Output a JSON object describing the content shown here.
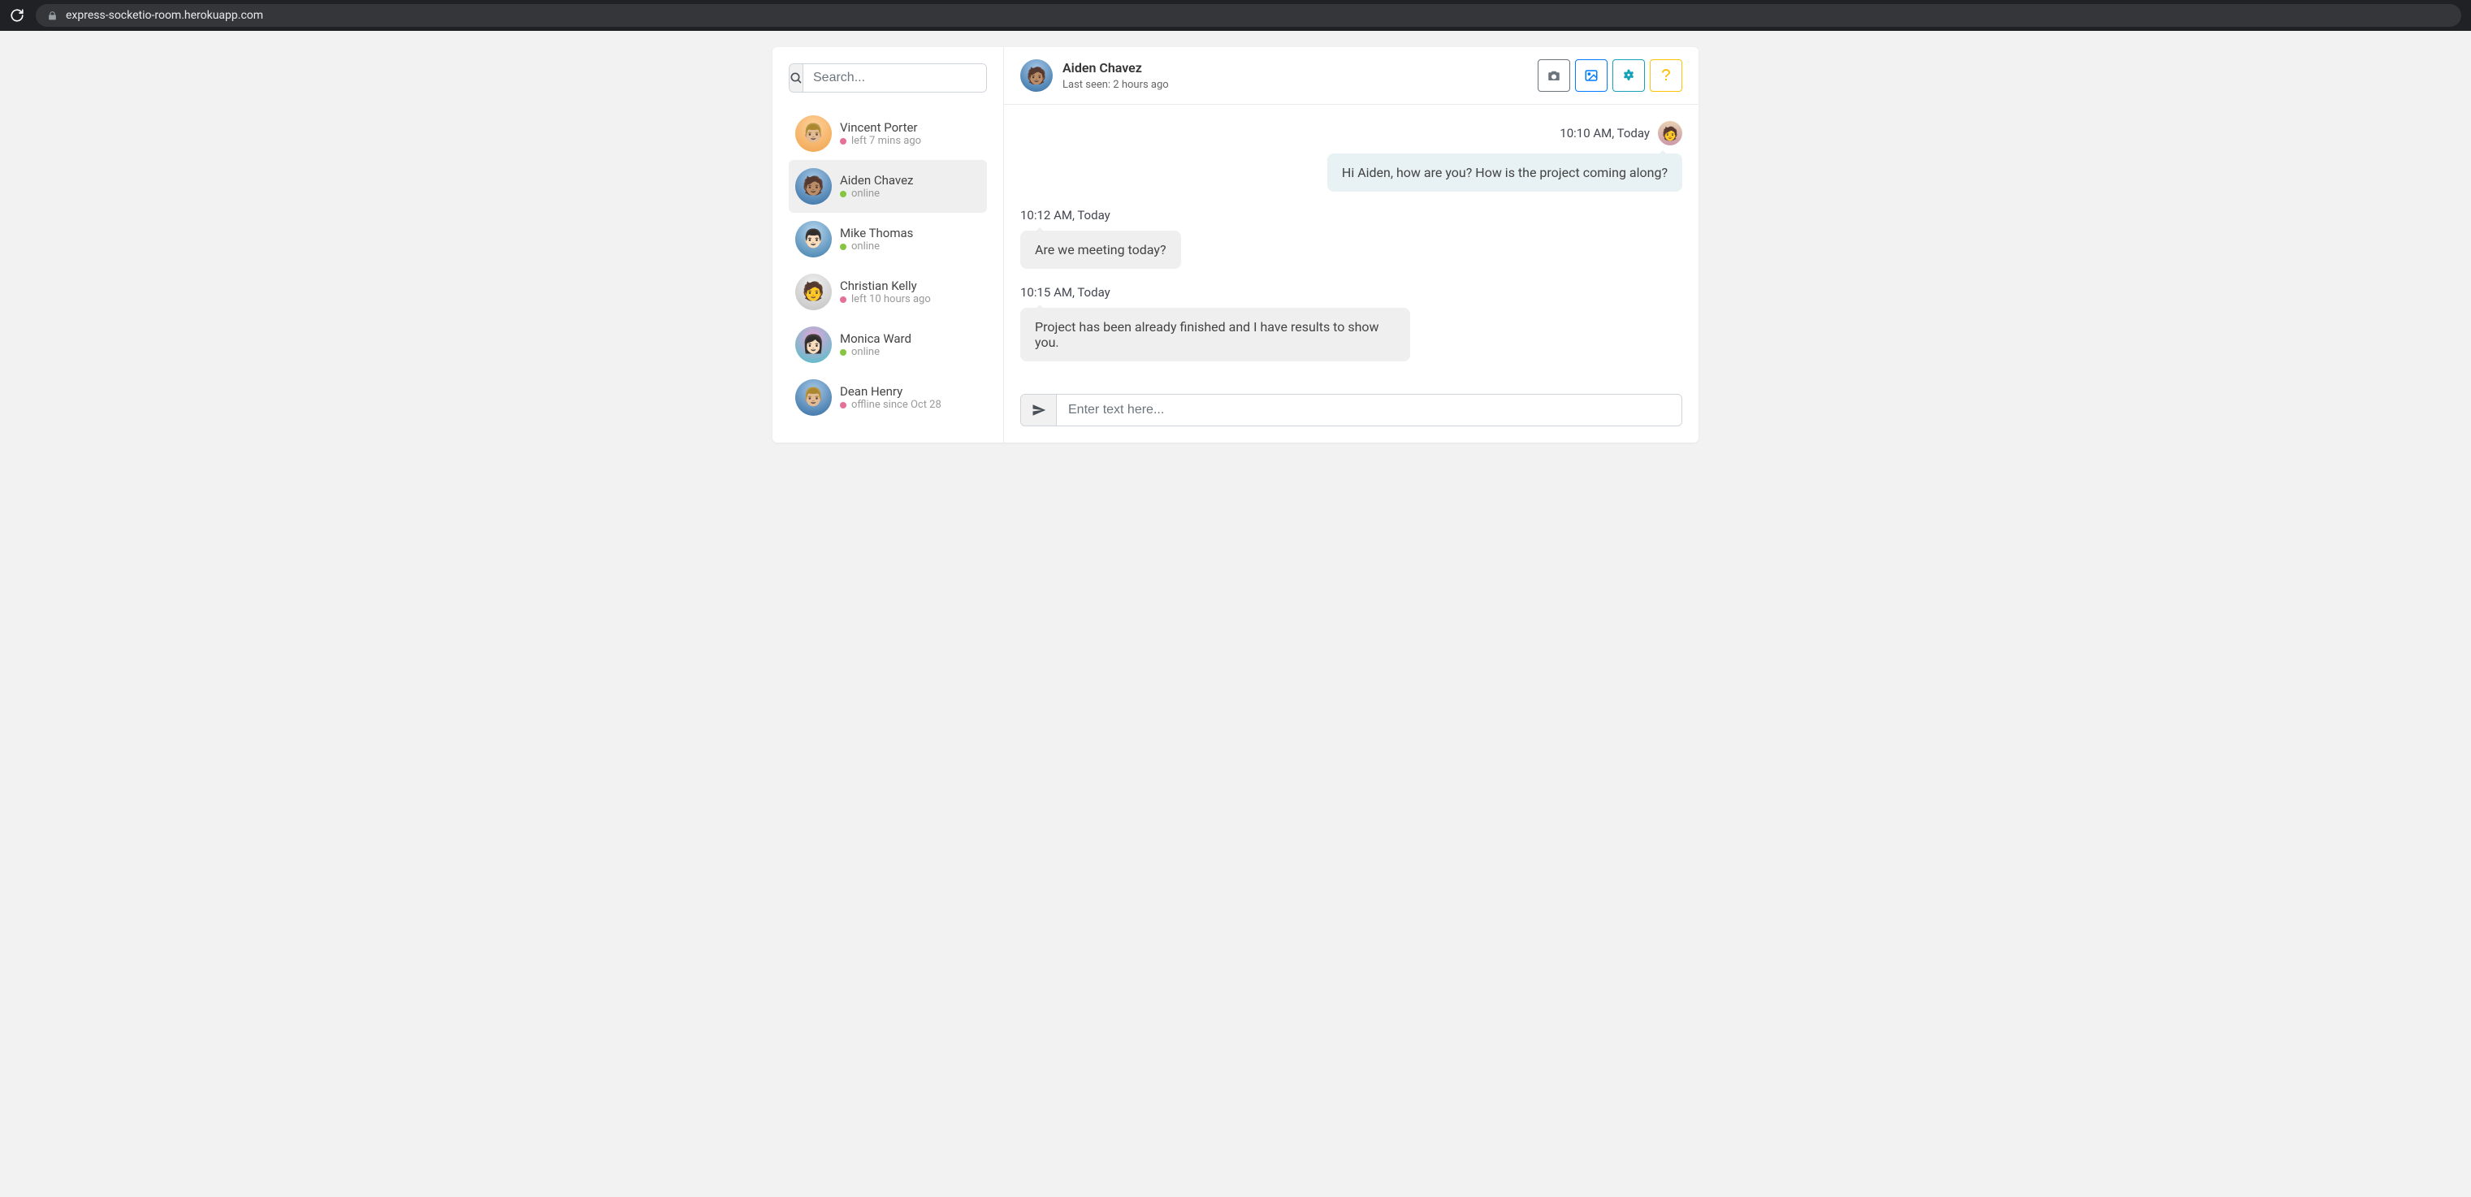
{
  "browser": {
    "url": "express-socketio-room.herokuapp.com"
  },
  "sidebar": {
    "search_placeholder": "Search...",
    "contacts": [
      {
        "name": "Vincent Porter",
        "status_text": "left 7 mins ago",
        "status": "away"
      },
      {
        "name": "Aiden Chavez",
        "status_text": "online",
        "status": "online"
      },
      {
        "name": "Mike Thomas",
        "status_text": "online",
        "status": "online"
      },
      {
        "name": "Christian Kelly",
        "status_text": "left 10 hours ago",
        "status": "away"
      },
      {
        "name": "Monica Ward",
        "status_text": "online",
        "status": "online"
      },
      {
        "name": "Dean Henry",
        "status_text": "offline since Oct 28",
        "status": "offline"
      }
    ]
  },
  "chat": {
    "header": {
      "name": "Aiden Chavez",
      "subtitle": "Last seen: 2 hours ago"
    },
    "messages": [
      {
        "mine": true,
        "time": "10:10 AM, Today",
        "text": "Hi Aiden, how are you? How is the project coming along?"
      },
      {
        "mine": false,
        "time": "10:12 AM, Today",
        "text": "Are we meeting today?"
      },
      {
        "mine": false,
        "time": "10:15 AM, Today",
        "text": "Project has been already finished and I have results to show you."
      }
    ],
    "input_placeholder": "Enter text here..."
  }
}
